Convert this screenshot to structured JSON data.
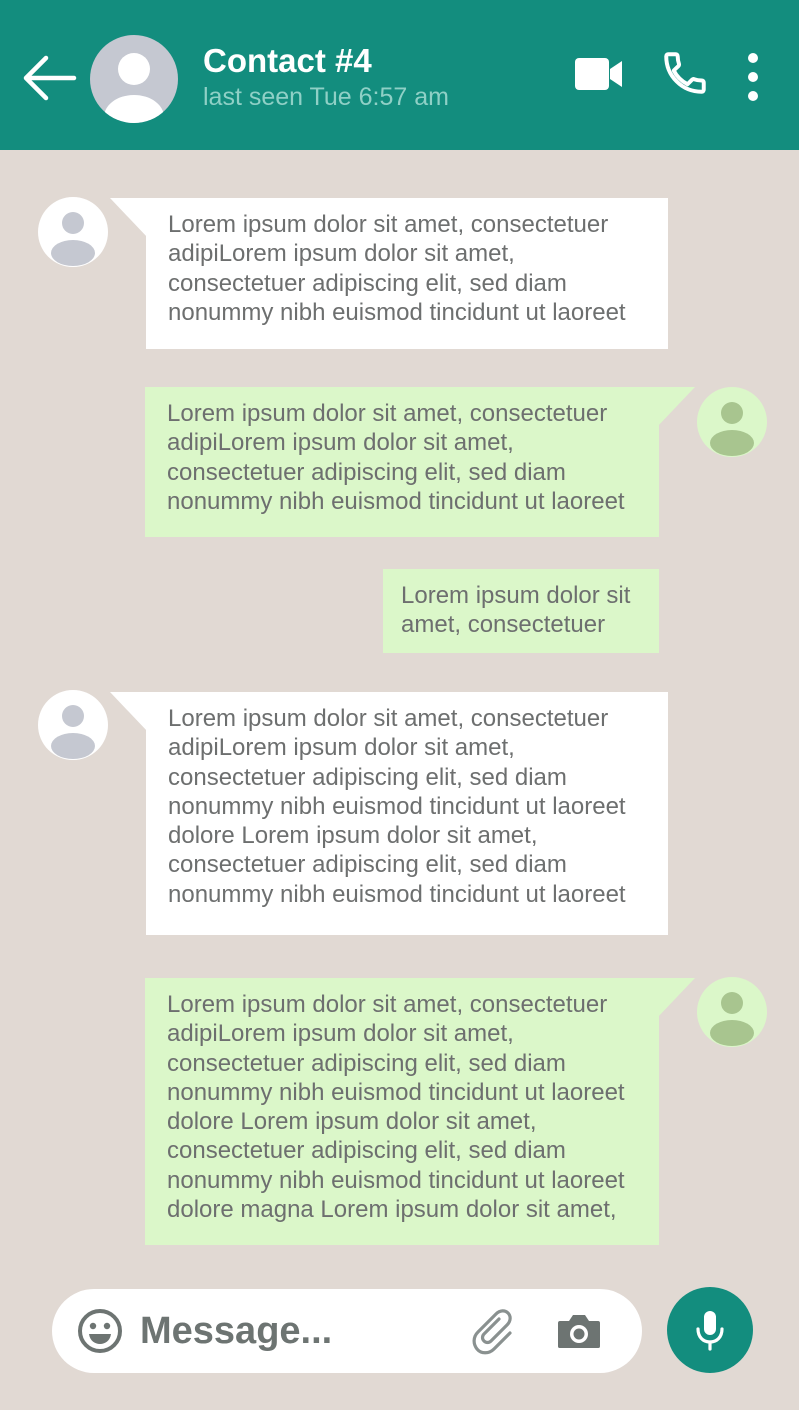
{
  "header": {
    "contact_name": "Contact #4",
    "last_seen": "last seen Tue 6:57 am",
    "icons": [
      "back-arrow-icon",
      "avatar-icon",
      "video-call-icon",
      "phone-icon",
      "more-vert-icon"
    ]
  },
  "messages": [
    {
      "direction": "incoming",
      "text": "Lorem ipsum dolor sit amet, consectetuer\nadipiLorem ipsum dolor sit amet,\nconsectetuer adipiscing elit, sed diam\nnonummy nibh euismod tincidunt ut laoreet"
    },
    {
      "direction": "outgoing",
      "text": "Lorem ipsum dolor sit amet, consectetuer\nadipiLorem ipsum dolor sit amet,\nconsectetuer adipiscing elit, sed diam\nnonummy nibh euismod tincidunt ut laoreet"
    },
    {
      "direction": "outgoing",
      "text": "Lorem ipsum dolor sit\namet, consectetuer"
    },
    {
      "direction": "incoming",
      "text": "Lorem ipsum dolor sit amet, consectetuer\nadipiLorem ipsum dolor sit amet,\nconsectetuer adipiscing elit, sed diam\nnonummy nibh euismod tincidunt ut laoreet\ndolore Lorem ipsum dolor sit amet,\nconsectetuer adipiscing elit, sed diam\nnonummy nibh euismod tincidunt ut laoreet"
    },
    {
      "direction": "outgoing",
      "text": "Lorem ipsum dolor sit amet, consectetuer\nadipiLorem ipsum dolor sit amet,\nconsectetuer adipiscing elit, sed diam\nnonummy nibh euismod tincidunt ut laoreet\ndolore Lorem ipsum dolor sit amet,\nconsectetuer adipiscing elit, sed diam\nnonummy nibh euismod tincidunt ut laoreet\ndolore magna Lorem ipsum dolor sit amet,"
    }
  ],
  "input": {
    "placeholder": "Message...",
    "icons": [
      "emoji-icon",
      "paperclip-icon",
      "camera-icon",
      "microphone-icon"
    ]
  },
  "colors": {
    "header": "#138d7e",
    "background": "#e1d9d3",
    "incoming_bubble": "#ffffff",
    "outgoing_bubble": "#dbf7c9",
    "text": "#6d6f6f",
    "last_seen": "#8fd0c6"
  }
}
